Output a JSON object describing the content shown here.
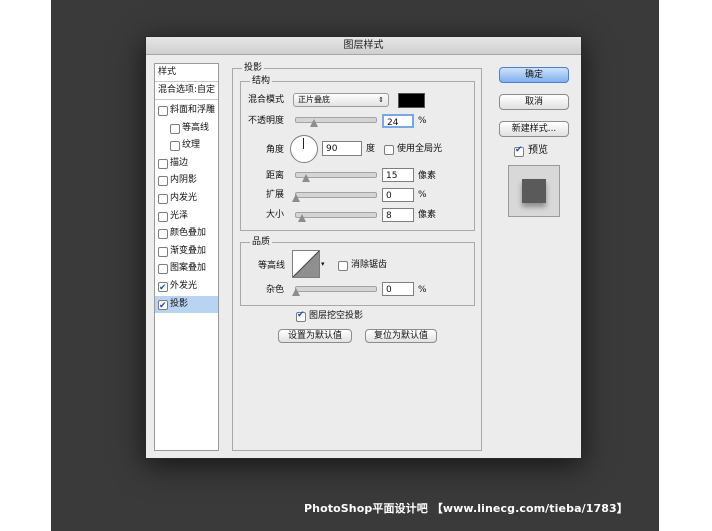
{
  "dialog": {
    "title": "图层样式"
  },
  "style_list": {
    "header": "样式",
    "blend_options": "混合选项:自定",
    "items": [
      {
        "label": "斜面和浮雕",
        "checked": false,
        "indent": false
      },
      {
        "label": "等高线",
        "checked": false,
        "indent": true
      },
      {
        "label": "纹理",
        "checked": false,
        "indent": true
      },
      {
        "label": "描边",
        "checked": false,
        "indent": false
      },
      {
        "label": "内阴影",
        "checked": false,
        "indent": false
      },
      {
        "label": "内发光",
        "checked": false,
        "indent": false
      },
      {
        "label": "光泽",
        "checked": false,
        "indent": false
      },
      {
        "label": "颜色叠加",
        "checked": false,
        "indent": false
      },
      {
        "label": "渐变叠加",
        "checked": false,
        "indent": false
      },
      {
        "label": "图案叠加",
        "checked": false,
        "indent": false
      },
      {
        "label": "外发光",
        "checked": true,
        "indent": false
      },
      {
        "label": "投影",
        "checked": true,
        "indent": false,
        "selected": true
      }
    ]
  },
  "shadow": {
    "section_title": "投影",
    "structure": {
      "title": "结构",
      "blend_mode_label": "混合模式",
      "blend_mode_value": "正片叠底",
      "blend_color": "#000000",
      "opacity_label": "不透明度",
      "opacity_value": "24",
      "opacity_unit": "%",
      "angle_label": "角度",
      "angle_value": "90",
      "angle_unit": "度",
      "global_light_label": "使用全局光",
      "global_light_checked": false,
      "distance_label": "距离",
      "distance_value": "15",
      "distance_unit": "像素",
      "spread_label": "扩展",
      "spread_value": "0",
      "spread_unit": "%",
      "size_label": "大小",
      "size_value": "8",
      "size_unit": "像素"
    },
    "quality": {
      "title": "品质",
      "contour_label": "等高线",
      "anti_alias_label": "消除锯齿",
      "anti_alias_checked": false,
      "noise_label": "杂色",
      "noise_value": "0",
      "noise_unit": "%"
    },
    "knockout_label": "图层挖空投影",
    "knockout_checked": true,
    "make_default_label": "设置为默认值",
    "reset_default_label": "复位为默认值"
  },
  "buttons": {
    "ok": "确定",
    "cancel": "取消",
    "new_style": "新建样式...",
    "preview_label": "预览",
    "preview_checked": true
  },
  "watermark": "PhotoShop平面设计吧 【www.linecg.com/tieba/1783】"
}
